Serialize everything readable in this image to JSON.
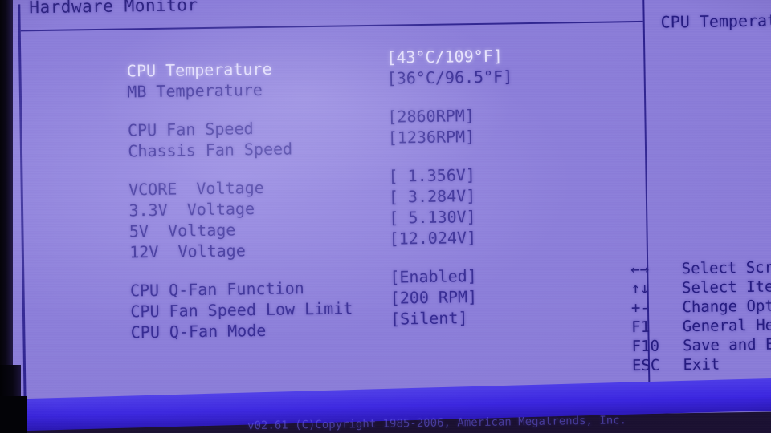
{
  "screen": {
    "title": "Hardware Monitor",
    "accent_text_color": "#2a1f8a",
    "selected_text_color": "#efecff",
    "background_color": "#8a7cd8",
    "frame_color": "#2a1f8c"
  },
  "items": [
    {
      "label": "CPU Temperature",
      "value": "[43°C/109°F]",
      "selected": true
    },
    {
      "label": "MB Temperature",
      "value": "[36°C/96.5°F]",
      "selected": false
    },
    {
      "label": "CPU Fan Speed",
      "value": "[2860RPM]",
      "selected": false
    },
    {
      "label": "Chassis Fan Speed",
      "value": "[1236RPM]",
      "selected": false
    },
    {
      "label": "VCORE  Voltage",
      "value": "[ 1.356V]",
      "selected": false
    },
    {
      "label": "3.3V  Voltage",
      "value": "[ 3.284V]",
      "selected": false
    },
    {
      "label": "5V  Voltage",
      "value": "[ 5.130V]",
      "selected": false
    },
    {
      "label": "12V  Voltage",
      "value": "[12.024V]",
      "selected": false
    },
    {
      "label": "CPU Q-Fan Function",
      "value": "[Enabled]",
      "selected": false
    },
    {
      "label": "CPU Fan Speed Low Limit",
      "value": "[200 RPM]",
      "selected": false
    },
    {
      "label": "CPU Q-Fan Mode",
      "value": "[Silent]",
      "selected": false
    }
  ],
  "help_panel": {
    "title": "CPU Temperature"
  },
  "legend": [
    {
      "key": "←→",
      "action": "Select Screen"
    },
    {
      "key": "↑↓",
      "action": "Select Item"
    },
    {
      "key": "+-",
      "action": "Change Option"
    },
    {
      "key": "F1",
      "action": "General Help"
    },
    {
      "key": "F10",
      "action": "Save and Exit"
    },
    {
      "key": "ESC",
      "action": "Exit"
    }
  ],
  "footer": {
    "copyright": "v02.61 (C)Copyright 1985-2006, American Megatrends, Inc."
  }
}
